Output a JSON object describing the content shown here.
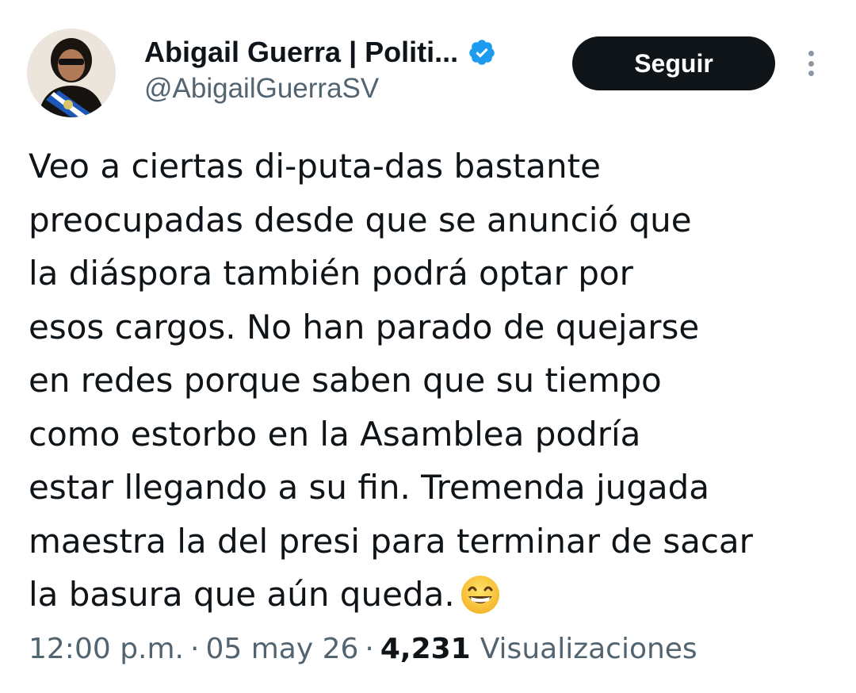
{
  "author": {
    "display_name": "Abigail Guerra | Politi...",
    "handle": "@AbigailGuerraSV",
    "verified": true
  },
  "follow_button_label": "Seguir",
  "tweet": {
    "lines": [
      "Veo a ciertas di-puta-das bastante",
      "preocupadas desde que se anunció que",
      "la diáspora también podrá optar por",
      "esos cargos. No han parado de quejarse",
      "en redes porque saben que su tiempo",
      "como estorbo en la Asamblea podría",
      "estar llegando a su fin. Tremenda jugada",
      "maestra la del presi para terminar de sacar",
      "la basura que aún queda."
    ],
    "emoji": "grinning-face-with-smiling-eyes"
  },
  "meta": {
    "time": "12:00 p.m.",
    "separator": "·",
    "date": "05 may 26",
    "views_count": "4,231",
    "views_label": "Visualizaciones"
  },
  "colors": {
    "text": "#0f1419",
    "secondary": "#536471",
    "verified": "#1d9bf0",
    "button_bg": "#0f1419"
  }
}
